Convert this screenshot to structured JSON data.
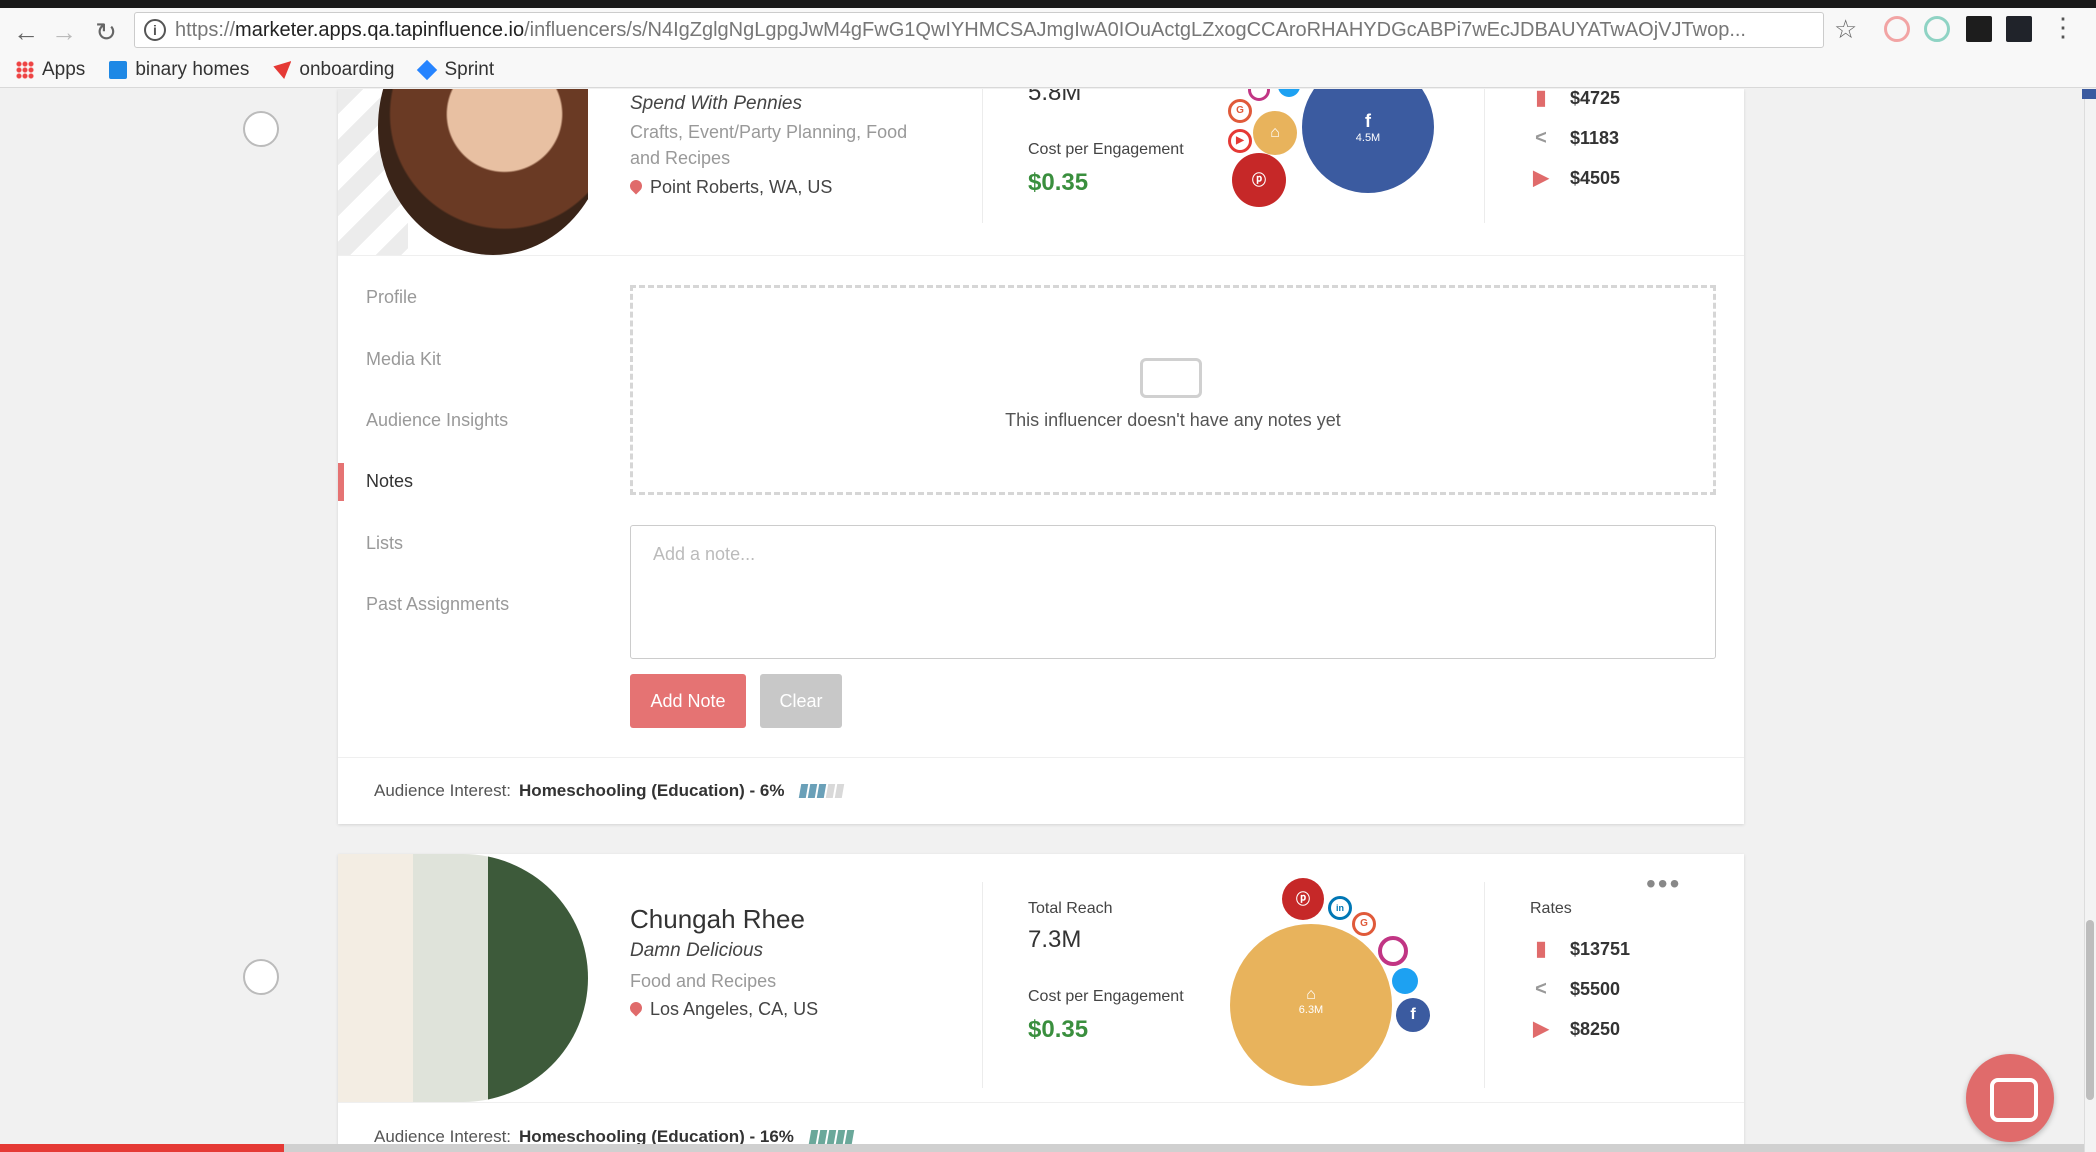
{
  "browser": {
    "url_prefix": "https://",
    "url_host": "marketer.apps.qa.tapinfluence.io",
    "url_path": "/influencers/s/N4IgZglgNgLgpgJwM4gFwG1QwIYHMCSAJmgIwA0IOuActgLZxogCCAroRHAHYDGcABPi7wEcJDBAUYATwAOjVJTwop...",
    "bookmarks": [
      "Apps",
      "binary homes",
      "onboarding",
      "Sprint"
    ]
  },
  "influencer1": {
    "blog": "Spend With Pennies",
    "categories": "Crafts, Event/Party Planning, Food and Recipes",
    "location": "Point Roberts, WA, US",
    "total_reach": "5.8M",
    "cpe_label": "Cost per Engagement",
    "cpe": "$0.35",
    "fb_reach": "4.5M",
    "rates": [
      "$4725",
      "$1183",
      "$4505"
    ]
  },
  "tabs": [
    "Profile",
    "Media Kit",
    "Audience Insights",
    "Notes",
    "Lists",
    "Past Assignments"
  ],
  "notes": {
    "empty_text": "This influencer doesn't have any notes yet",
    "placeholder": "Add a note...",
    "add_label": "Add Note",
    "clear_label": "Clear"
  },
  "interest1": {
    "label": "Audience Interest:",
    "value": "Homeschooling (Education) - 6%",
    "level": 0.6
  },
  "influencer2": {
    "name": "Chungah Rhee",
    "blog": "Damn Delicious",
    "categories": "Food and Recipes",
    "location": "Los Angeles, CA, US",
    "reach_label": "Total Reach",
    "total_reach": "7.3M",
    "cpe_label": "Cost per Engagement",
    "cpe": "$0.35",
    "blog_reach": "6.3M",
    "rates_label": "Rates",
    "rates": [
      "$13751",
      "$5500",
      "$8250"
    ],
    "more": "•••"
  },
  "interest2": {
    "label": "Audience Interest:",
    "value": "Homeschooling (Education) - 16%",
    "level": 1.0
  },
  "colors": {
    "accent": "#e57373",
    "green": "#3a8f3e",
    "facebook": "#3b5ba0",
    "blog": "#e8b35c",
    "pinterest": "#c62828",
    "meter_fill": "#6aa0b8"
  }
}
